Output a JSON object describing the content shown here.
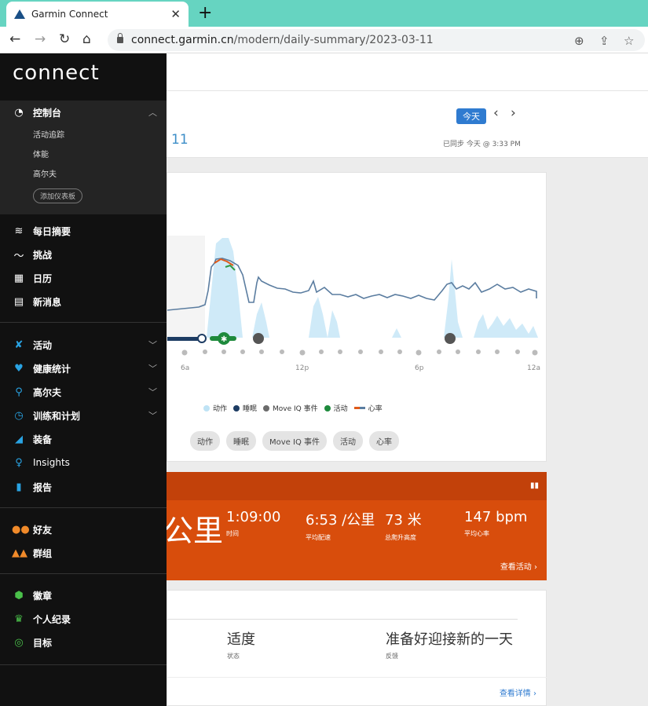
{
  "browser": {
    "tab_title": "Garmin Connect",
    "tab_close": "✕",
    "new_tab": "+",
    "url_host": "connect.garmin.cn",
    "url_path": "/modern/daily-summary/2023-03-11"
  },
  "sidebar": {
    "brand": "connect",
    "dashboard": {
      "label": "控制台",
      "subitems": [
        "活动追踪",
        "体能",
        "高尔夫"
      ],
      "add_button": "添加仪表板"
    },
    "group1": [
      {
        "label": "每日摘要",
        "icon": "layers-icon"
      },
      {
        "label": "挑战",
        "icon": "challenge-icon"
      },
      {
        "label": "日历",
        "icon": "calendar-icon"
      },
      {
        "label": "新消息",
        "icon": "news-icon"
      }
    ],
    "group2": [
      {
        "label": "活动",
        "icon": "running-person-icon"
      },
      {
        "label": "健康统计",
        "icon": "heart-icon"
      },
      {
        "label": "高尔夫",
        "icon": "golfer-icon"
      },
      {
        "label": "训练和计划",
        "icon": "stopwatch-icon"
      },
      {
        "label": "装备",
        "icon": "shoe-icon"
      },
      {
        "label": "Insights",
        "icon": "lightbulb-icon"
      },
      {
        "label": "报告",
        "icon": "bar-chart-icon"
      }
    ],
    "group3": [
      {
        "label": "好友",
        "icon": "friends-icon"
      },
      {
        "label": "群组",
        "icon": "groups-icon"
      }
    ],
    "group4": [
      {
        "label": "徽章",
        "icon": "badge-icon"
      },
      {
        "label": "个人纪录",
        "icon": "trophy-icon"
      },
      {
        "label": "目标",
        "icon": "target-icon"
      }
    ]
  },
  "header": {
    "date_fragment": "11",
    "today_button": "今天",
    "synced": "已同步 今天 @ 3:33 PM"
  },
  "chart": {
    "x_ticks": [
      "6a",
      "12p",
      "6p",
      "12a"
    ],
    "legend": [
      {
        "label": "动作",
        "color": "#bfe3f5"
      },
      {
        "label": "睡眠",
        "color": "#1d3c63"
      },
      {
        "label": "Move IQ 事件",
        "color": "#6b6b6b"
      },
      {
        "label": "活动",
        "color": "#1e8a3c"
      },
      {
        "label": "心率",
        "color": "#e05a1a"
      }
    ],
    "filters": [
      "动作",
      "睡眠",
      "Move IQ 事件",
      "活动",
      "心率"
    ]
  },
  "activity": {
    "distance_fragment": "公里",
    "stats": [
      {
        "value": "1:09:00",
        "label": "时间"
      },
      {
        "value": "6:53 /公里",
        "label": "平均配速"
      },
      {
        "value": "73 米",
        "label": "总爬升高度"
      },
      {
        "value": "147 bpm",
        "label": "平均心率"
      }
    ],
    "view_link": "查看活动"
  },
  "readiness": {
    "stats": [
      {
        "value": "适度",
        "label": "状态"
      },
      {
        "value": "准备好迎接新的一天",
        "label": "反馈"
      }
    ],
    "view_link": "查看详情"
  },
  "colors": {
    "tabbar": "#66d4c1",
    "accent_blue": "#2f7bd0",
    "activity_orange": "#d84d0c",
    "sidebar_bg": "#111111"
  }
}
